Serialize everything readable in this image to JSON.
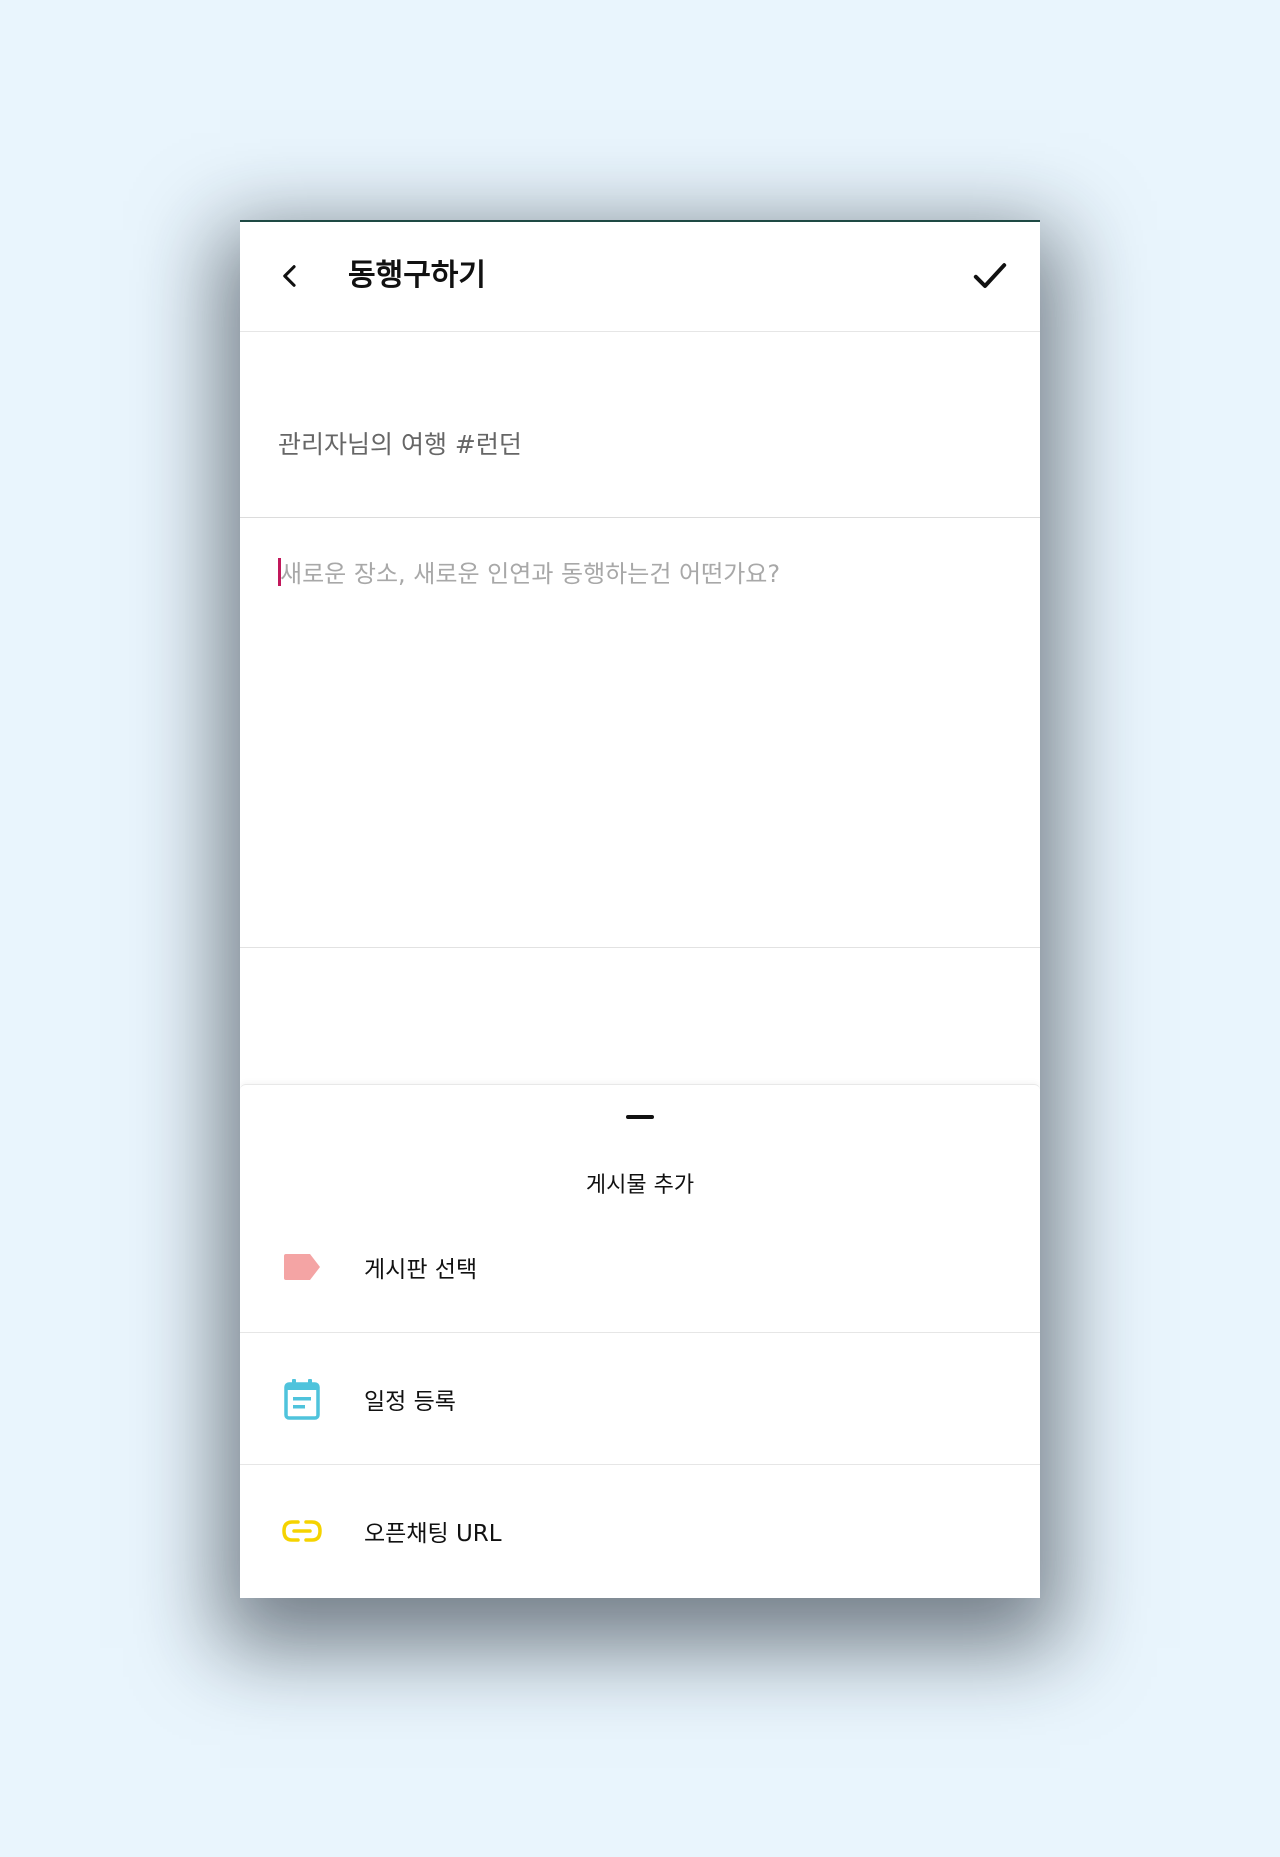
{
  "header": {
    "title": "동행구하기",
    "back_icon": "chevron-left-icon",
    "confirm_icon": "checkmark-icon"
  },
  "post": {
    "title_value": "관리자님의 여행 #런던",
    "body_placeholder": "새로운 장소, 새로운 인연과 동행하는건 어떤가요?"
  },
  "sheet": {
    "title": "게시물 추가",
    "items": [
      {
        "label": "게시판 선택",
        "icon": "tag-icon",
        "color": "#f4a4a4"
      },
      {
        "label": "일정 등록",
        "icon": "calendar-icon",
        "color": "#4fc3dc"
      },
      {
        "label": "오픈채팅 URL",
        "icon": "link-icon",
        "color": "#f5d300"
      }
    ]
  },
  "colors": {
    "background": "#e9f5fd",
    "caret": "#c2185b"
  }
}
